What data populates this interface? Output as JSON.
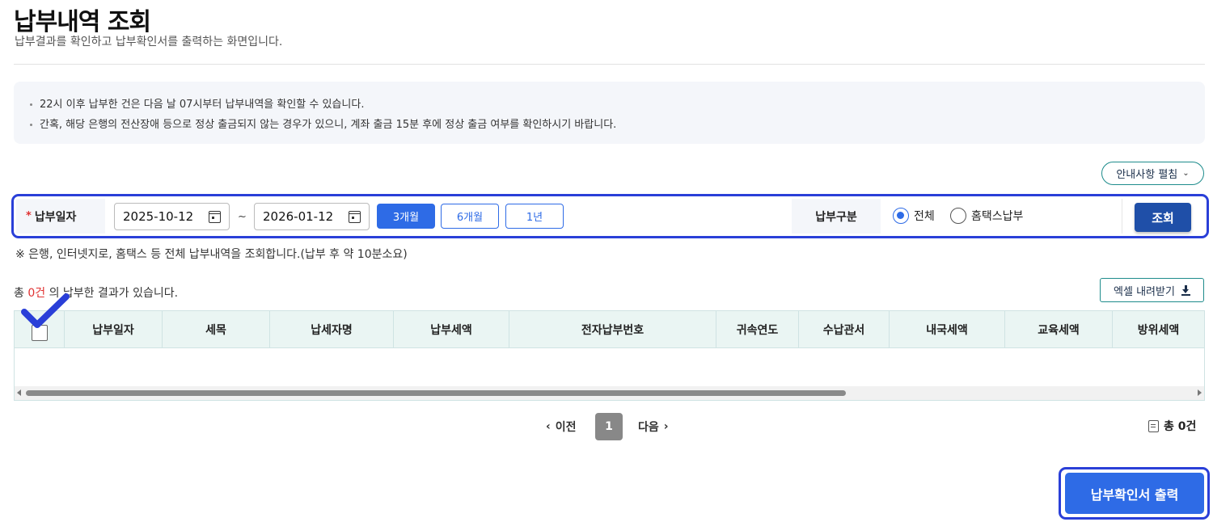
{
  "page": {
    "title": "납부내역 조회",
    "description": "납부결과를 확인하고 납부확인서를 출력하는 화면입니다."
  },
  "notice": {
    "lines": [
      "22시 이후 납부한 건은 다음 날 07시부터 납부내역을 확인할 수 있습니다.",
      "간혹, 해당 은행의 전산장애 등으로 정상 출금되지 않는 경우가 있으니, 계좌 출금 15분 후에 정상 출금 여부를 확인하시기 바랍니다."
    ],
    "expand_label": "안내사항 펼침"
  },
  "search": {
    "date_label": "납부일자",
    "required_mark": "*",
    "date_from": "2025-10-12",
    "date_to": "2026-01-12",
    "range_sep": "~",
    "periods": [
      "3개월",
      "6개월",
      "1년"
    ],
    "selected_period": "3개월",
    "type_label": "납부구분",
    "type_options": [
      "전체",
      "홈택스납부"
    ],
    "selected_type": "전체",
    "search_button": "조회",
    "note": "※ 은행, 인터넷지로, 홈택스 등 전체 납부내역을 조회합니다.(납부 후 약 10분소요)"
  },
  "results": {
    "prefix": "총 ",
    "count": "0건",
    "suffix": " 의 납부한 결과가 있습니다.",
    "excel_button": "엑셀 내려받기"
  },
  "table": {
    "columns": [
      "납부일자",
      "세목",
      "납세자명",
      "납부세액",
      "전자납부번호",
      "귀속연도",
      "수납관서",
      "내국세액",
      "교육세액",
      "방위세액"
    ],
    "rows": []
  },
  "pagination": {
    "prev": "이전",
    "current_page": "1",
    "next": "다음",
    "total": "총 0건"
  },
  "actions": {
    "print_button": "납부확인서 출력"
  },
  "colors": {
    "primary": "#2e6be6",
    "dark_button": "#1f4fa8",
    "highlight_outline": "#2a3fd8",
    "count_red": "#e03131",
    "table_header_bg": "#eaf5f3"
  }
}
